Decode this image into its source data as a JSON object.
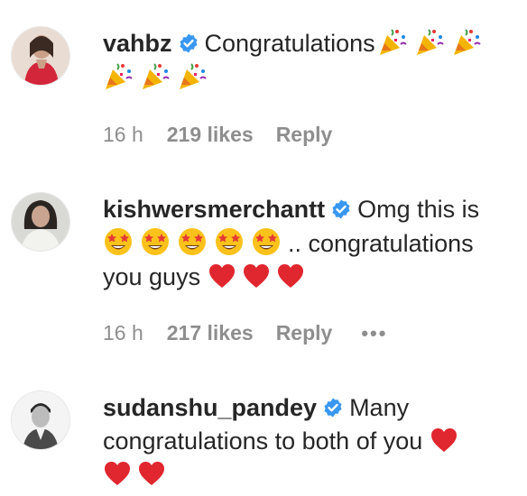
{
  "comments": [
    {
      "username": "vahbz",
      "verified": true,
      "text": "Congratulations",
      "emoji_after": "party-popper x6",
      "time": "16 h",
      "likes": "219 likes",
      "reply": "Reply"
    },
    {
      "username": "kishwersmerchantt",
      "verified": true,
      "text_part1": "Omg this is",
      "emoji_middle": "star-struck x5",
      "text_part2": ".. congratulations",
      "text_part3": "you guys",
      "emoji_after": "red-heart x3",
      "time": "16 h",
      "likes": "217 likes",
      "reply": "Reply",
      "more": "•••"
    },
    {
      "username": "sudanshu_pandey",
      "verified": true,
      "text_part1": "Many",
      "text_part2": "congratulations to both of you",
      "emoji_after": "red-heart x3"
    }
  ],
  "colors": {
    "text": "#262626",
    "meta": "#8e8e8e",
    "verified": "#3897f0",
    "heart": "#e0262e"
  }
}
